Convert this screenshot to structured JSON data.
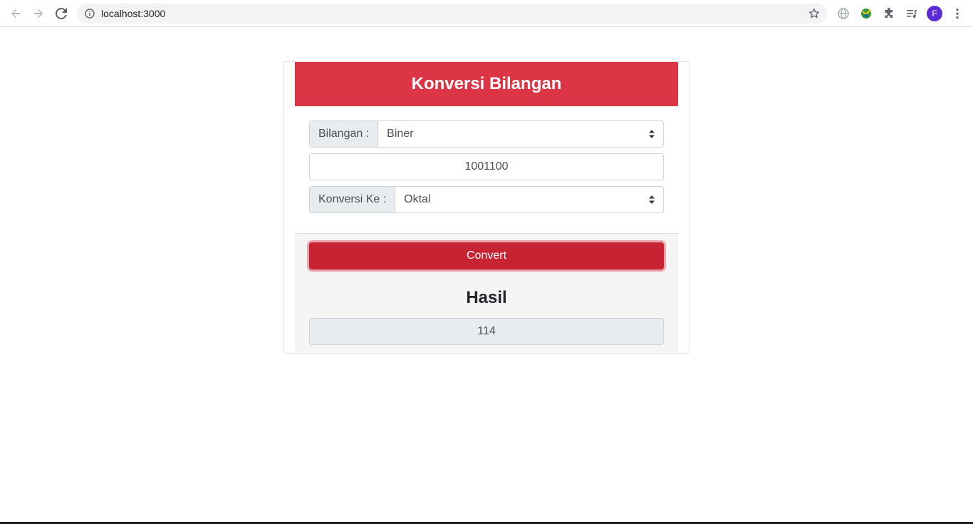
{
  "browser": {
    "url": "localhost:3000",
    "profile_initial": "F",
    "profile_color": "#5b2bd6"
  },
  "app": {
    "title": "Konversi Bilangan",
    "accent_color": "#dc3545",
    "from_label": "Bilangan :",
    "from_value": "Biner",
    "input_value": "1001100",
    "to_label": "Konversi Ke :",
    "to_value": "Oktal",
    "convert_label": "Convert",
    "result_title": "Hasil",
    "result_value": "114"
  }
}
